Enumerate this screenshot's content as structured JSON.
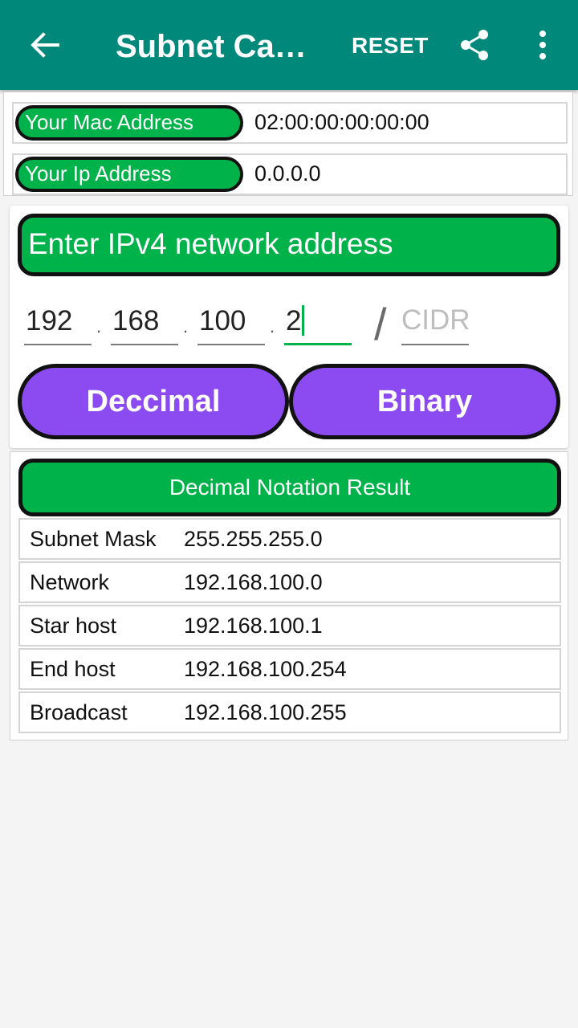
{
  "appbar": {
    "title": "Subnet Calc...",
    "reset_label": "RESET",
    "background": "#00897b"
  },
  "device_info": {
    "mac_label": "Your Mac Address",
    "mac_value": "02:00:00:00:00:00",
    "ip_label": "Your Ip Address",
    "ip_value": "0.0.0.0"
  },
  "input": {
    "header": "Enter IPv4 network address",
    "octets": [
      "192",
      "168",
      "100",
      "2"
    ],
    "separator": ".",
    "cidr_separator": "/",
    "cidr_placeholder": "CIDR",
    "cidr_value": ""
  },
  "buttons": {
    "decimal": "Deccimal",
    "binary": "Binary"
  },
  "result": {
    "header": "Decimal Notation Result",
    "rows": [
      {
        "key": "Subnet Mask",
        "value": "255.255.255.0"
      },
      {
        "key": "Network",
        "value": "192.168.100.0"
      },
      {
        "key": "Star host",
        "value": "192.168.100.1"
      },
      {
        "key": "End host",
        "value": "192.168.100.254"
      },
      {
        "key": "Broadcast",
        "value": "192.168.100.255"
      }
    ]
  },
  "colors": {
    "green": "#00b24a",
    "purple": "#8c4bf0",
    "teal": "#00897b"
  },
  "icons": {
    "back": "arrow-back-icon",
    "share": "share-icon",
    "more": "more-vert-icon"
  }
}
